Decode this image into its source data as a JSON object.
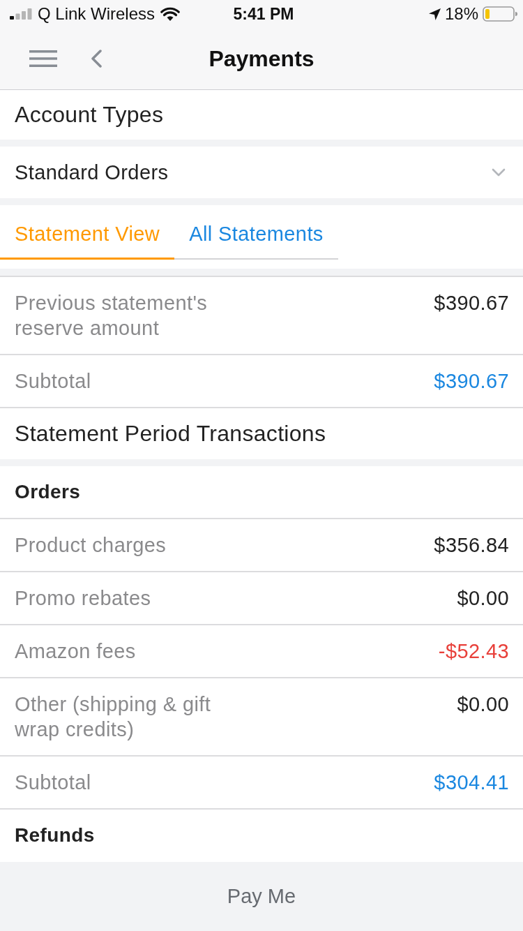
{
  "status_bar": {
    "carrier": "Q Link Wireless",
    "time": "5:41 PM",
    "battery": "18%"
  },
  "header": {
    "title": "Payments"
  },
  "account_types": {
    "title": "Account Types"
  },
  "dropdown": {
    "value": "Standard Orders"
  },
  "tabs": [
    {
      "label": "Statement View",
      "selected": true
    },
    {
      "label": "All Statements",
      "selected": false
    }
  ],
  "statement": {
    "rows": [
      {
        "kind": "item",
        "label": "Previous statement's reserve amount",
        "amount": "$390.67"
      },
      {
        "kind": "subtotal",
        "label": "Subtotal",
        "amount": "$390.67"
      },
      {
        "kind": "section",
        "label": "Statement Period Transactions"
      },
      {
        "kind": "group",
        "label": "Orders"
      },
      {
        "kind": "item",
        "label": "Product charges",
        "amount": "$356.84"
      },
      {
        "kind": "item",
        "label": "Promo rebates",
        "amount": "$0.00"
      },
      {
        "kind": "deduction",
        "label": "Amazon fees",
        "amount": "-$52.43"
      },
      {
        "kind": "item",
        "label": "Other (shipping & gift wrap credits)",
        "amount": "$0.00"
      },
      {
        "kind": "subtotal",
        "label": "Subtotal",
        "amount": "$304.41"
      },
      {
        "kind": "group",
        "label": "Refunds"
      }
    ]
  },
  "footer": {
    "button": "Pay Me"
  }
}
